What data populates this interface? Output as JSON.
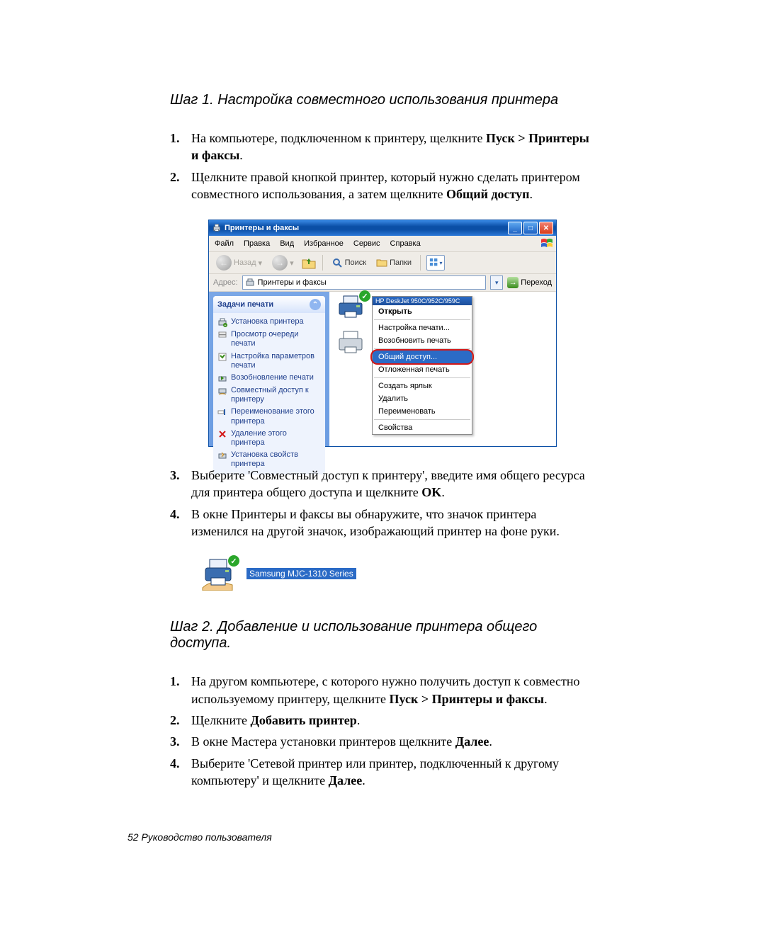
{
  "step1": {
    "heading": "Шаг 1. Настройка совместного использования принтера",
    "items": [
      {
        "n": "1.",
        "pre": "На компьютере, подключенном к принтеру, щелкните ",
        "bold": "Пуск > Принтеры и факсы",
        "post": "."
      },
      {
        "n": "2.",
        "pre": "Щелкните правой кнопкой принтер, который нужно сделать принтером совместного использования, а затем щелкните ",
        "bold": "Общий доступ",
        "post": "."
      }
    ],
    "items_b": [
      {
        "n": "3.",
        "pre": "Выберите 'Совместный доступ к принтеру', введите имя общего ресурса для принтера общего доступа и щелкните ",
        "bold": "OK",
        "post": "."
      },
      {
        "n": "4.",
        "pre": "В окне Принтеры и факсы вы обнаружите, что значок принтера изменился на другой значок, изображающий принтер на фоне руки.",
        "bold": "",
        "post": ""
      }
    ],
    "shared_printer_label": "Samsung MJC-1310 Series"
  },
  "step2": {
    "heading": "Шаг 2. Добавление и использование принтера общего доступа.",
    "items": [
      {
        "n": "1.",
        "pre": "На другом компьютере, с которого нужно получить доступ к совместно используемому принтеру, щелкните ",
        "bold": "Пуск > Принтеры и факсы",
        "post": "."
      },
      {
        "n": "2.",
        "pre": "Щелкните ",
        "bold": "Добавить принтер",
        "post": "."
      },
      {
        "n": "3.",
        "pre": "В окне Мастера установки принтеров щелкните ",
        "bold": "Далее",
        "post": "."
      },
      {
        "n": "4.",
        "pre": "Выберите 'Сетевой принтер или принтер, подключенный к другому компьютеру' и щелкните ",
        "bold": "Далее",
        "post": "."
      }
    ]
  },
  "xp": {
    "title": "Принтеры и факсы",
    "menu": [
      "Файл",
      "Правка",
      "Вид",
      "Избранное",
      "Сервис",
      "Справка"
    ],
    "toolbar": {
      "back": "Назад",
      "search": "Поиск",
      "folders": "Папки"
    },
    "addressbar": {
      "label": "Адрес:",
      "value": "Принтеры и факсы",
      "go": "Переход"
    },
    "taskpane": {
      "group_title": "Задачи печати",
      "items": [
        "Установка принтера",
        "Просмотр очереди печати",
        "Настройка параметров печати",
        "Возобновление печати",
        "Совместный доступ к принтеру",
        "Переименование этого принтера",
        "Удаление этого принтера",
        "Установка свойств принтера"
      ]
    },
    "context": {
      "title_bar": "HP DeskJet 950C/952C/959C",
      "open": "Открыть",
      "print_setup": "Настройка печати...",
      "resume_print": "Возобновить печать",
      "sharing": "Общий доступ...",
      "offline": "Отложенная печать",
      "create_shortcut": "Создать ярлык",
      "delete": "Удалить",
      "rename": "Переименовать",
      "properties": "Свойства"
    }
  },
  "footer": "52  Руководство пользователя"
}
